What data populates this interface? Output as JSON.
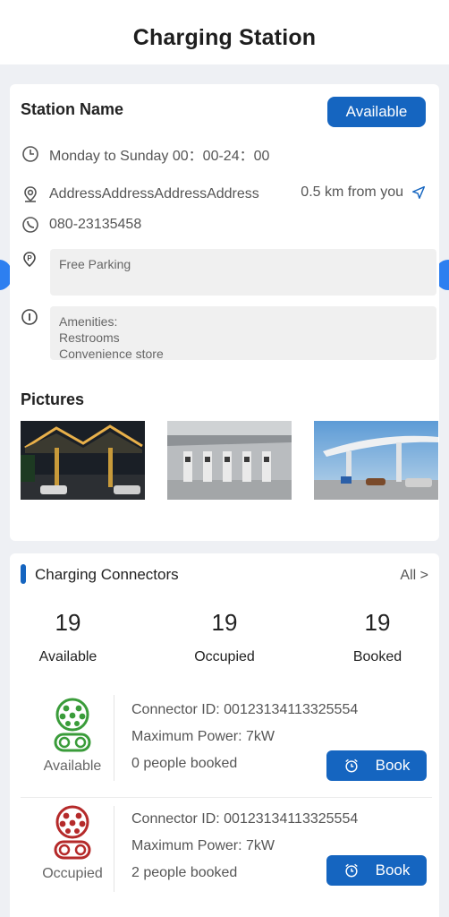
{
  "header": {
    "title": "Charging Station"
  },
  "station": {
    "name_label": "Station Name",
    "status": "Available",
    "hours": "Monday to Sunday 00：00-24：00",
    "address": "AddressAddressAddressAddress",
    "distance": "0.5 km from you",
    "phone": "080-23135458",
    "parking": "Free Parking",
    "amenities": [
      "Amenities:",
      "Restrooms",
      "Convenience store"
    ],
    "pictures_label": "Pictures"
  },
  "connectors": {
    "title": "Charging Connectors",
    "all_label": "All >",
    "stats": [
      {
        "count": "19",
        "label": "Available"
      },
      {
        "count": "19",
        "label": "Occupied"
      },
      {
        "count": "19",
        "label": "Booked"
      }
    ],
    "items": [
      {
        "status": "Available",
        "status_color": "#3a9c3a",
        "id_line": "Connector ID: 00123134113325554",
        "power_line": "Maximum Power: 7kW",
        "booked_line": "0 people booked",
        "book_label": "Book"
      },
      {
        "status": "Occupied",
        "status_color": "#b52a2a",
        "id_line": "Connector ID: 00123134113325554",
        "power_line": "Maximum Power: 7kW",
        "booked_line": "2 people booked",
        "book_label": "Book"
      }
    ]
  },
  "colors": {
    "accent": "#1565c0",
    "background": "#eef0f4"
  },
  "icons": [
    "clock-icon",
    "location-icon",
    "phone-icon",
    "parking-icon",
    "info-icon",
    "navigate-icon",
    "alarm-icon",
    "connector-icon"
  ]
}
